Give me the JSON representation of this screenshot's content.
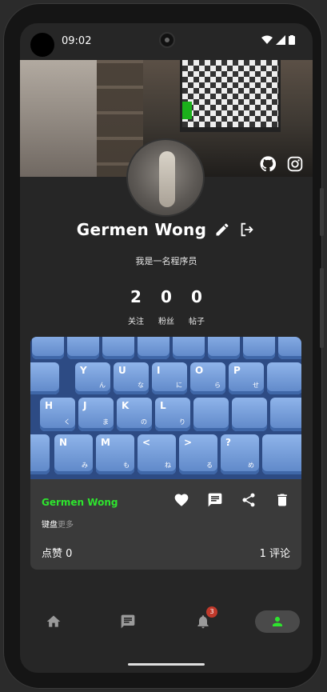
{
  "status_bar": {
    "time": "09:02"
  },
  "profile": {
    "name": "Germen Wong",
    "bio": "我是一名程序员",
    "stats": [
      {
        "value": "2",
        "label": "关注"
      },
      {
        "value": "0",
        "label": "粉丝"
      },
      {
        "value": "0",
        "label": "帖子"
      }
    ]
  },
  "post": {
    "author": "Germen Wong",
    "tag": "键盘",
    "more": "更多",
    "likes": "点赞 0",
    "comments": "1 评论",
    "keys": [
      [
        "Y",
        "ん"
      ],
      [
        "U",
        "な"
      ],
      [
        "I",
        "に"
      ],
      [
        "O",
        "ら"
      ],
      [
        "P",
        "せ"
      ],
      [
        "H",
        "く"
      ],
      [
        "J",
        "ま"
      ],
      [
        "K",
        "の"
      ],
      [
        "L",
        "り"
      ],
      [
        "N",
        "み"
      ],
      [
        "M",
        "も"
      ],
      [
        "<",
        "ね"
      ],
      [
        ">",
        "る"
      ],
      [
        "?",
        "め"
      ]
    ]
  },
  "nav": {
    "notification_badge": "3"
  },
  "colors": {
    "accent_green": "#2ee42e",
    "badge_red": "#c0392b",
    "background": "#262626"
  }
}
